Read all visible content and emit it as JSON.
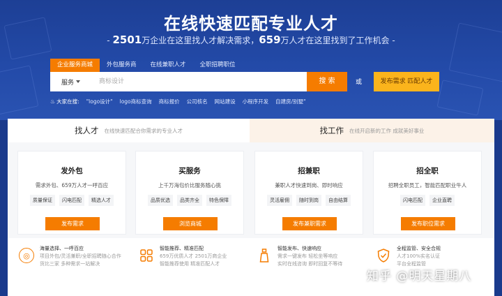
{
  "hero": {
    "title": "在线快速匹配专业人才",
    "subtitle_prefix": "- ",
    "stat1": "2501",
    "subtitle_mid1": "万企业在这里找人才解决需求，",
    "stat2": "659",
    "subtitle_mid2": "万人才在这里找到了工作机会 -"
  },
  "search": {
    "tabs": [
      "企业服务商城",
      "外包服务商",
      "在线兼职人才",
      "全职招聘职位"
    ],
    "select_label": "服务",
    "placeholder": "商标设计",
    "button": "搜 索",
    "or": "或",
    "publish_button": "发布需求 匹配人才",
    "hot_label": "大家在搜:",
    "hot_items": [
      "\"logo设计\"",
      "logo商标查询",
      "商标报价",
      "公司核名",
      "网站建设",
      "小程序开发",
      "自建房/别墅\""
    ]
  },
  "panel": {
    "left_tab": {
      "name": "找人才",
      "desc": "在线快速匹配合你需求的专业人才"
    },
    "right_tab": {
      "name": "找工作",
      "desc": "在线开启新的工作 成就美好事业"
    },
    "cards": [
      {
        "name": "发外包",
        "desc": "需求外包、659万人才一呼百应",
        "tags": [
          "质量保证",
          "闪电匹配",
          "精选人才"
        ],
        "button": "发布需求"
      },
      {
        "name": "买服务",
        "desc": "上千万海包价比服务随心挑",
        "tags": [
          "品质优选",
          "品类齐全",
          "特色保障"
        ],
        "button": "浏览商城"
      },
      {
        "name": "招兼职",
        "desc": "兼职人才快速到岗、即时响应",
        "tags": [
          "灵活雇佣",
          "随时到岗",
          "自由结算"
        ],
        "button": "发布兼职需求"
      },
      {
        "name": "招全职",
        "desc": "招聘全职员工，智能匹配职业牛人",
        "tags": [
          "闪电匹配",
          "企业直聘"
        ],
        "button": "发布职位需求"
      }
    ],
    "features": [
      {
        "icon": "target-icon",
        "title": "海量选择、一呼百应",
        "line2": "项目外包/灵活兼职/全职招聘随心合作",
        "line3": "货比三家 多种需求一站解决"
      },
      {
        "icon": "grid-icon",
        "title": "智能推荐、精准匹配",
        "line2": "659万优质人才 2501万商企业",
        "line3": "智能推荐使用 精准匹配人才"
      },
      {
        "icon": "bottle-icon",
        "title": "智能发布、快速响应",
        "line2": "需求一键发布 轻松坐等响应",
        "line3": "实时在线咨询 即时回复不等待"
      },
      {
        "icon": "shield-icon",
        "title": "全程监管、安全合规",
        "line2": "人才100%实名认证",
        "line3": "平台全程监管"
      }
    ]
  },
  "watermark": "知乎 @明天星期八"
}
